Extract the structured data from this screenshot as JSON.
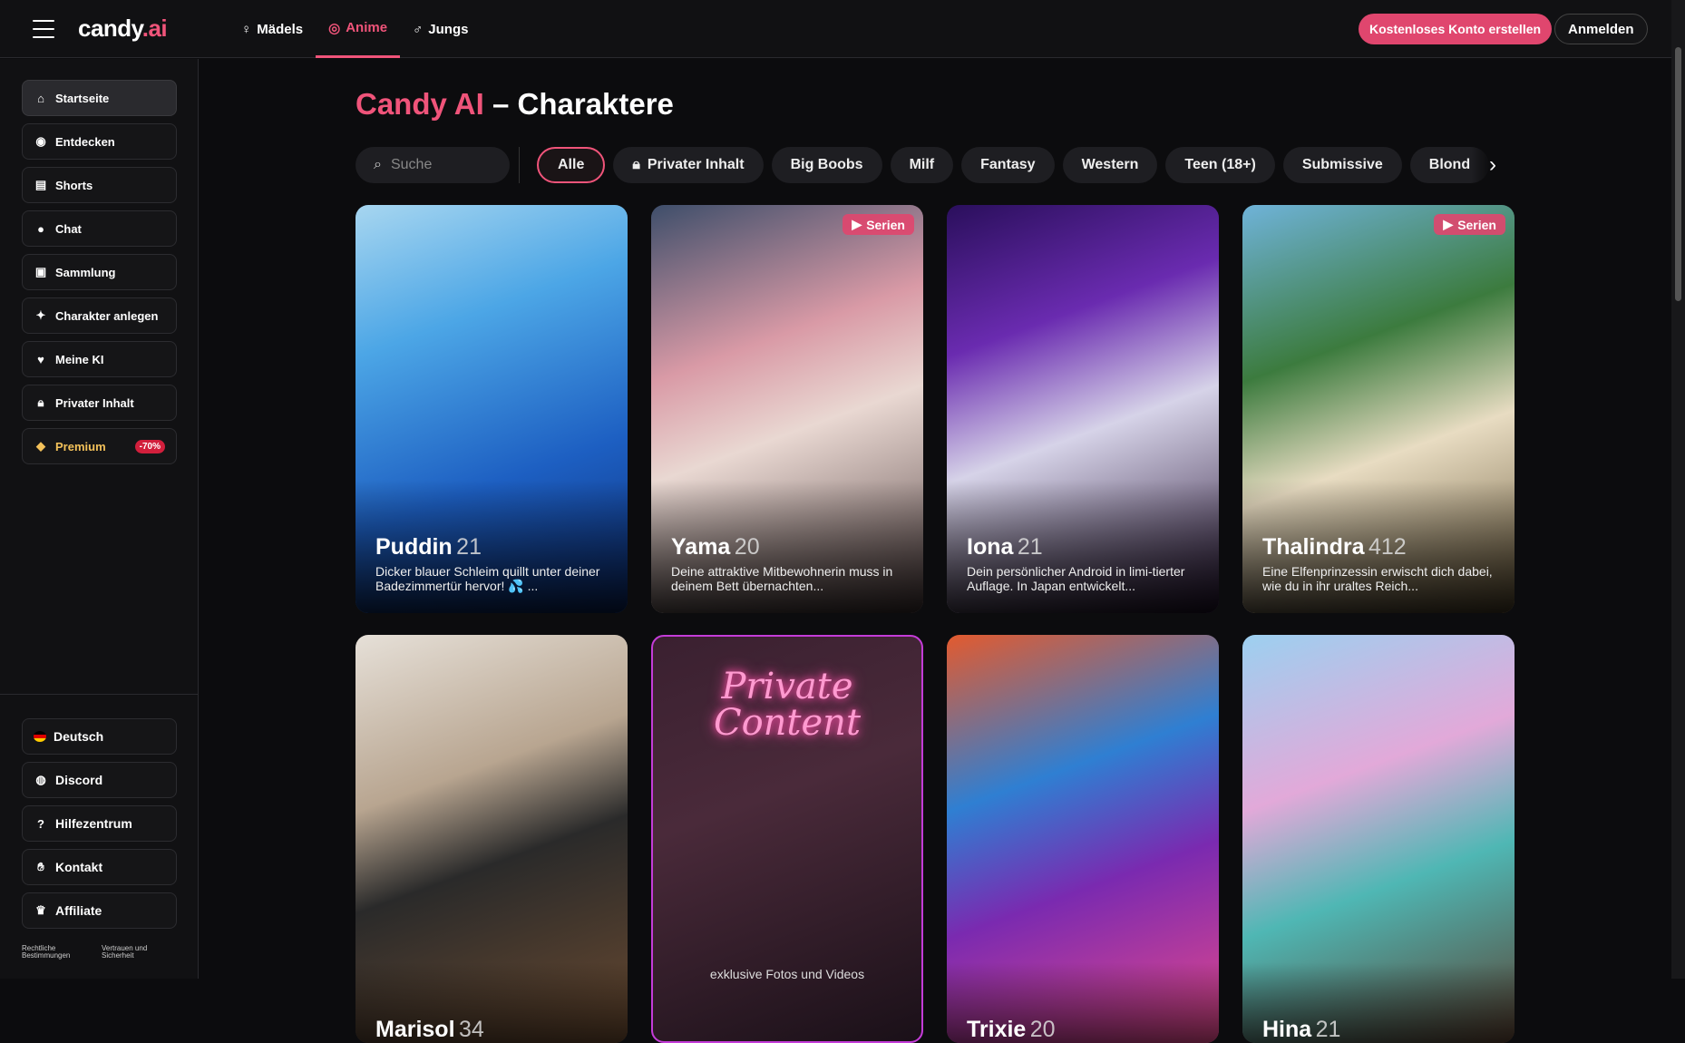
{
  "header": {
    "logo_main": "candy",
    "logo_dot": ".ai",
    "tabs": [
      {
        "label": "Mädels",
        "icon": "female-icon"
      },
      {
        "label": "Anime",
        "icon": "anime-icon",
        "active": true
      },
      {
        "label": "Jungs",
        "icon": "male-icon"
      }
    ],
    "create_account": "Kostenloses Konto erstellen",
    "login": "Anmelden"
  },
  "sidebar": {
    "items": [
      {
        "label": "Startseite",
        "icon": "home-icon",
        "active": true
      },
      {
        "label": "Entdecken",
        "icon": "compass-icon"
      },
      {
        "label": "Shorts",
        "icon": "shorts-icon"
      },
      {
        "label": "Chat",
        "icon": "chat-icon"
      },
      {
        "label": "Sammlung",
        "icon": "collection-icon"
      },
      {
        "label": "Charakter anlegen",
        "icon": "magic-wand-icon"
      },
      {
        "label": "Meine KI",
        "icon": "heart-icon"
      },
      {
        "label": "Privater Inhalt",
        "icon": "lock-icon"
      },
      {
        "label": "Premium",
        "icon": "diamond-icon",
        "badge": "-70%"
      }
    ],
    "bottom_items": [
      {
        "label": "Deutsch",
        "icon": "german-flag-icon"
      },
      {
        "label": "Discord",
        "icon": "discord-icon"
      },
      {
        "label": "Hilfezentrum",
        "icon": "help-icon"
      },
      {
        "label": "Kontakt",
        "icon": "handshake-icon"
      },
      {
        "label": "Affiliate",
        "icon": "trophy-icon"
      }
    ],
    "legal": [
      "Rechtliche Bestimmungen",
      "Vertrauen und Sicherheit"
    ]
  },
  "main": {
    "title_brand": "Candy AI",
    "title_rest": " – Charaktere",
    "search_placeholder": "Suche",
    "filters": [
      {
        "label": "Alle",
        "active": true
      },
      {
        "label": "Privater Inhalt",
        "icon": "lock-icon"
      },
      {
        "label": "Big Boobs"
      },
      {
        "label": "Milf"
      },
      {
        "label": "Fantasy"
      },
      {
        "label": "Western"
      },
      {
        "label": "Teen (18+)"
      },
      {
        "label": "Submissive"
      },
      {
        "label": "Blond"
      }
    ],
    "cards": [
      {
        "name": "Puddin",
        "age": "21",
        "desc": "Dicker blauer Schleim quillt unter deiner Badezimmertür hervor! 💦 ..."
      },
      {
        "name": "Yama",
        "age": "20",
        "desc": "Deine attraktive Mitbewohnerin muss in deinem Bett übernachten...",
        "series": "Serien"
      },
      {
        "name": "Iona",
        "age": "21",
        "desc": "Dein persönlicher Android in limi-tierter Auflage. In Japan entwickelt..."
      },
      {
        "name": "Thalindra",
        "age": "412",
        "desc": "Eine Elfenprinzessin erwischt dich dabei, wie du in ihr uraltes Reich...",
        "series": "Serien"
      },
      {
        "name": "Marisol",
        "age": "34",
        "desc": ""
      },
      {
        "private_title": "Private Content",
        "private_sub": "exklusive Fotos und Videos"
      },
      {
        "name": "Trixie",
        "age": "20",
        "desc": ""
      },
      {
        "name": "Hina",
        "age": "21",
        "desc": ""
      }
    ]
  }
}
